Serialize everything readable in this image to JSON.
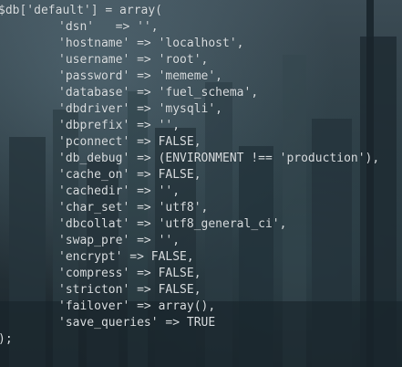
{
  "editor": {
    "lines": [
      "$db['default'] = array(",
      "'dsn'   => '',",
      "'hostname' => 'localhost',",
      "'username' => 'root',",
      "'password' => 'mememe',",
      "'database' => 'fuel_schema',",
      "'dbdriver' => 'mysqli',",
      "'dbprefix' => '',",
      "'pconnect' => FALSE,",
      "'db_debug' => (ENVIRONMENT !== 'production'),",
      "'cache_on' => FALSE,",
      "'cachedir' => '',",
      "'char_set' => 'utf8',",
      "'dbcollat' => 'utf8_general_ci',",
      "'swap_pre' => '',",
      "'encrypt' => FALSE,",
      "'compress' => FALSE,",
      "'stricton' => FALSE,",
      "'failover' => array(),",
      "'save_queries' => TRUE",
      ");"
    ]
  }
}
